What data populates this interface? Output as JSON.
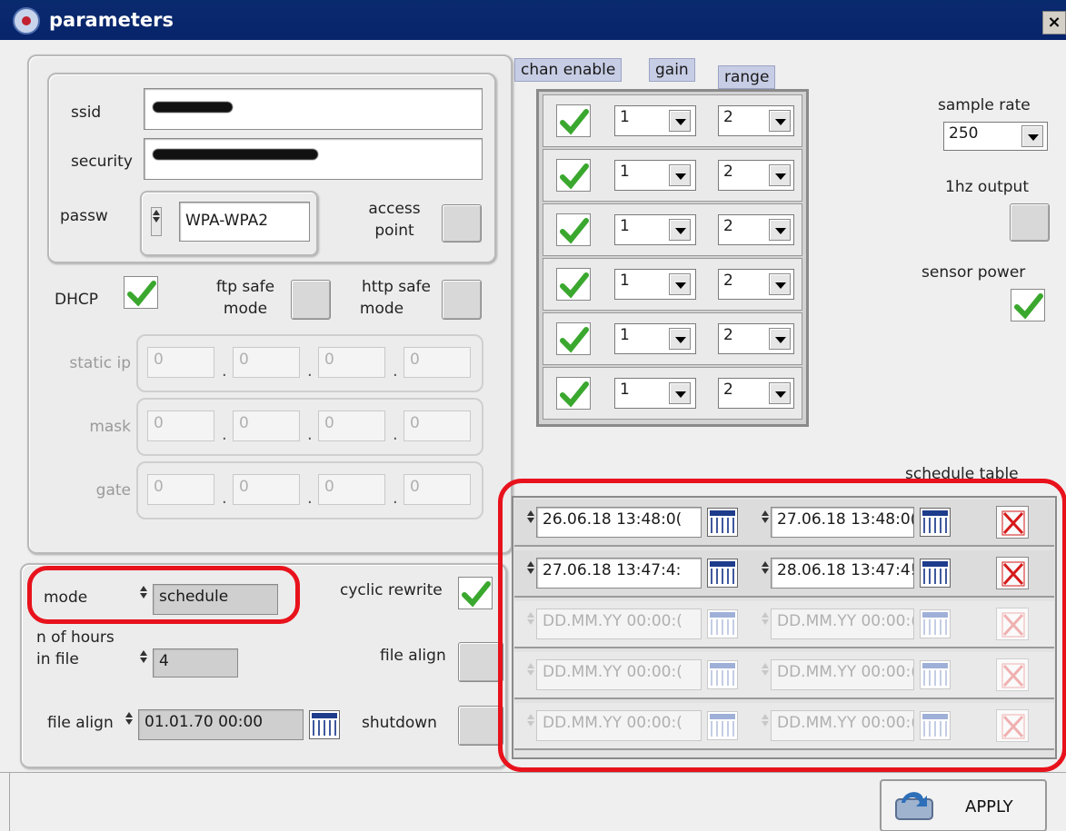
{
  "window": {
    "title": "parameters",
    "close_glyph": "×",
    "icon": "app-icon"
  },
  "wifi": {
    "ssid_label": "ssid",
    "security_label": "security",
    "passw_label": "passw",
    "passw_value": "WPA-WPA2",
    "access_point_label_1": "access",
    "access_point_label_2": "point"
  },
  "network": {
    "dhcp_label": "DHCP",
    "dhcp_checked": true,
    "ftp_safe_label_1": "ftp safe",
    "ftp_safe_label_2": "mode",
    "http_safe_label_1": "http safe",
    "http_safe_label_2": "mode",
    "rows": [
      {
        "label": "static ip",
        "octets": [
          "0",
          "0",
          "0",
          "0"
        ]
      },
      {
        "label": "mask",
        "octets": [
          "0",
          "0",
          "0",
          "0"
        ]
      },
      {
        "label": "gate",
        "octets": [
          "0",
          "0",
          "0",
          "0"
        ]
      }
    ]
  },
  "recording": {
    "mode_label": "mode",
    "mode_value": "schedule",
    "cyclic_rewrite_label": "cyclic rewrite",
    "cyclic_rewrite_checked": true,
    "hours_label_1": "n of hours",
    "hours_label_2": "in file",
    "hours_value": "4",
    "file_align_label": "file align",
    "file_align_button_label": "file align",
    "file_align_value": "01.01.70 00:00",
    "shutdown_label": "shutdown"
  },
  "channels": {
    "header_enable": "chan enable",
    "header_gain": "gain",
    "header_range": "range",
    "rows": [
      {
        "enabled": true,
        "gain": "1",
        "range": "2"
      },
      {
        "enabled": true,
        "gain": "1",
        "range": "2"
      },
      {
        "enabled": true,
        "gain": "1",
        "range": "2"
      },
      {
        "enabled": true,
        "gain": "1",
        "range": "2"
      },
      {
        "enabled": true,
        "gain": "1",
        "range": "2"
      },
      {
        "enabled": true,
        "gain": "1",
        "range": "2"
      }
    ]
  },
  "settings": {
    "sample_rate_label": "sample rate",
    "sample_rate_value": "250",
    "hz_output_label": "1hz output",
    "sensor_power_label": "sensor power",
    "sensor_power_checked": true
  },
  "schedule": {
    "title": "schedule table",
    "rows": [
      {
        "start": "26.06.18 13:48:0(",
        "end": "27.06.18 13:48:0(",
        "active": true
      },
      {
        "start": "27.06.18 13:47:4:",
        "end": "28.06.18 13:47:4!",
        "active": true
      },
      {
        "start": "DD.MM.YY 00:00:(",
        "end": "DD.MM.YY 00:00:(",
        "active": false
      },
      {
        "start": "DD.MM.YY 00:00:(",
        "end": "DD.MM.YY 00:00:(",
        "active": false
      },
      {
        "start": "DD.MM.YY 00:00:(",
        "end": "DD.MM.YY 00:00:(",
        "active": false
      }
    ]
  },
  "apply_label": "APPLY",
  "colors": {
    "title_bar": "#08246b",
    "highlight_red": "#e8121c",
    "check_green": "#3aa82e",
    "delete_red": "#d61a1a"
  }
}
